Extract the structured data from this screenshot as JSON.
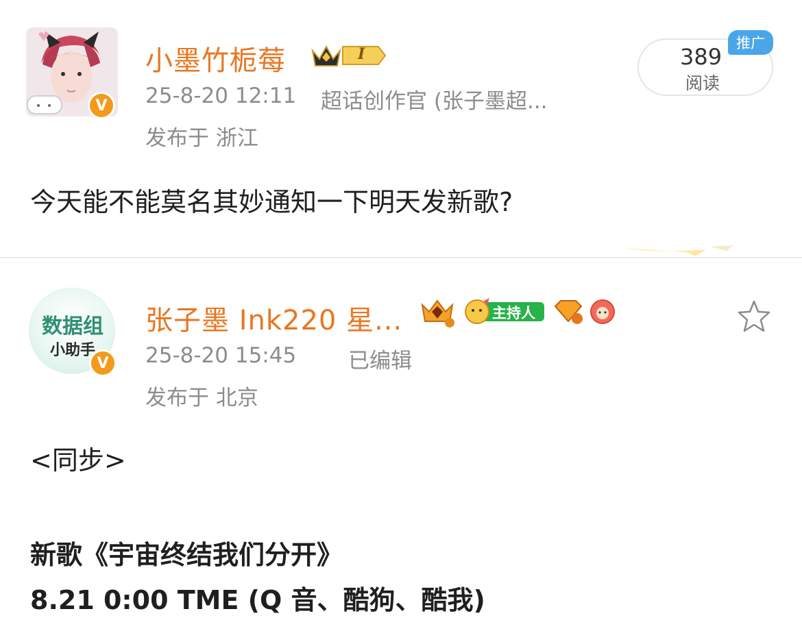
{
  "post1": {
    "username": "小墨竹栀莓",
    "level_badge": "I",
    "timestamp": "25-8-20 12:11",
    "source": "超话创作官 (张子墨超...",
    "location": "发布于 浙江",
    "content": "今天能不能莫名其妙通知一下明天发新歌?",
    "reads": {
      "count": "389",
      "label": "阅读",
      "promo": "推广"
    }
  },
  "post2": {
    "username": "张子墨 Ink220 星...",
    "avatar_text_line1": "数据组",
    "avatar_text_line2": "小助手",
    "host_badge": "主持人",
    "timestamp": "25-8-20 15:45",
    "edited": "已编辑",
    "location": "发布于 北京",
    "content_lines": [
      "<同步>",
      "新歌《宇宙终结我们分开》",
      "8.21 0:00 TME (Q 音、酷狗、酷我)"
    ]
  },
  "colors": {
    "username": "#e9761f",
    "meta": "#8c8c8c",
    "verified": "#f39a1c",
    "promo": "#4aa6e8",
    "host_badge": "#27b34a"
  },
  "icons": [
    "verified-icon",
    "crown-icon",
    "star-icon",
    "diamond-badge-icon",
    "host-badge-icon",
    "level-badge-icon",
    "fan-badge-icon"
  ]
}
